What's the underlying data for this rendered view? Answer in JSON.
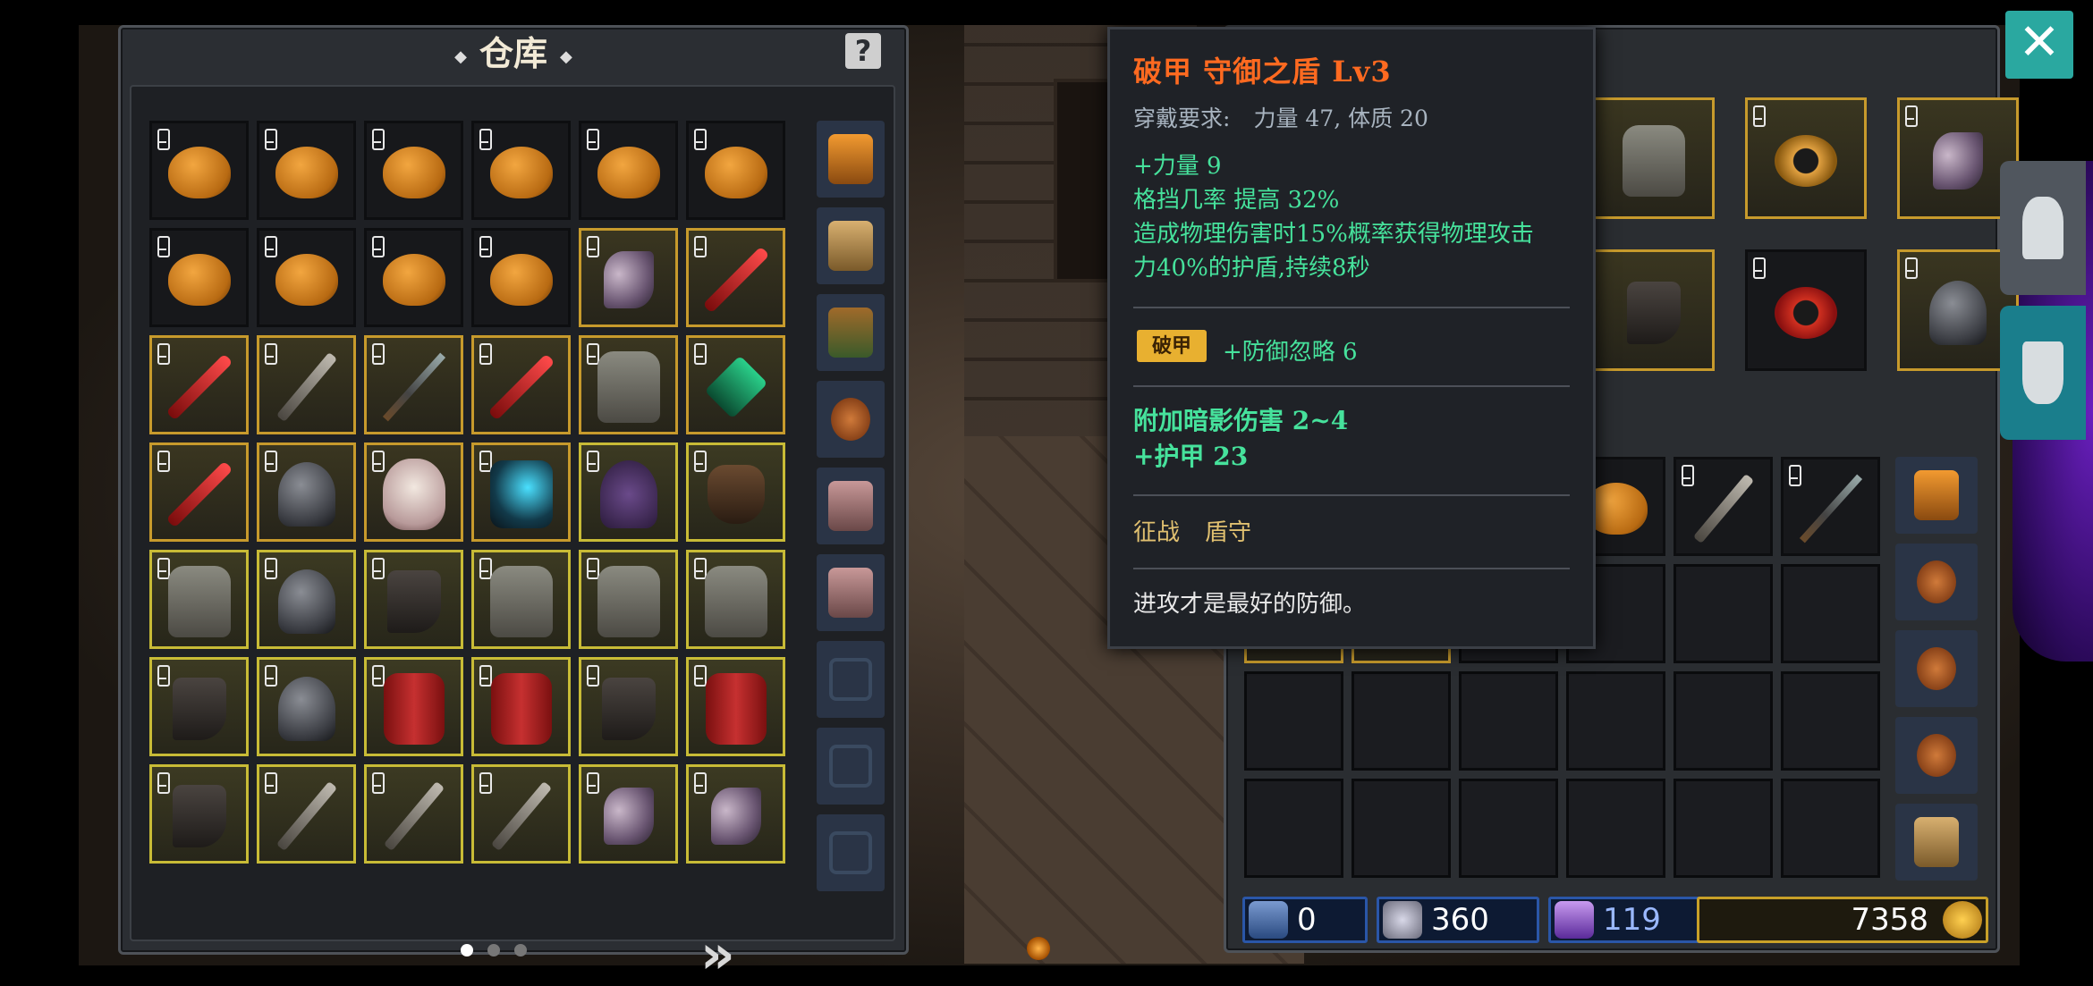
{
  "warehouse": {
    "title": "仓库",
    "help_label": "?",
    "grid": [
      [
        "bag",
        "bag",
        "bag",
        "bag",
        "bag",
        "bag"
      ],
      [
        "bag",
        "bag",
        "bag",
        "bag",
        "axe-gold",
        "blade-gold"
      ],
      [
        "blade-gold",
        "sword-gold",
        "spear-gold",
        "blade-gold",
        "armor-gold",
        "amulet-gold"
      ],
      [
        "blade-gold",
        "helm-gold",
        "skull-gold",
        "teal-gold",
        "purple-ygold",
        "glove-ygold"
      ],
      [
        "armor-ygold",
        "helm-ygold",
        "boot-ygold",
        "armor-ygold",
        "armor-ygold",
        "armor-ygold"
      ],
      [
        "boot-ygold",
        "helm-ygold",
        "red-ygold",
        "red-ygold",
        "boot-ygold",
        "red-ygold"
      ],
      [
        "boot-ygold",
        "sword-ygold",
        "sword-ygold",
        "sword-ygold",
        "axe-ygold",
        "axe-ygold"
      ]
    ],
    "side_tabs": [
      "orange",
      "tan",
      "green",
      "round",
      "pink",
      "pink",
      "locked",
      "locked",
      "locked"
    ],
    "next_label": "»",
    "pages": 3,
    "current_page": 1
  },
  "equipment": {
    "slots": [
      "armor-gold",
      "ring-gold",
      "axe-gold",
      "boot-gold",
      "ring-red",
      "helm-gold"
    ]
  },
  "inventory": {
    "grid": [
      [
        "empty",
        "empty",
        "empty",
        "bag",
        "sword",
        "spear"
      ],
      [
        "gold-partial",
        "gold-partial",
        "empty",
        "empty",
        "empty",
        "empty"
      ],
      [
        "empty",
        "empty",
        "empty",
        "empty",
        "empty",
        "empty"
      ],
      [
        "empty",
        "empty",
        "empty",
        "empty",
        "empty",
        "empty"
      ]
    ],
    "side_tabs": [
      "orange",
      "round",
      "round",
      "round",
      "tan"
    ]
  },
  "currency": {
    "crystal": "0",
    "shield": "360",
    "gem": "119",
    "gold": "7358"
  },
  "close_label": "✕",
  "tooltip": {
    "title": "破甲 守御之盾 Lv3",
    "req_label": "穿戴要求:",
    "req_value": "力量 47, 体质 20",
    "stats": [
      "+力量 9",
      "格挡几率 提高 32%",
      "造成物理伤害时15%概率获得物理攻击",
      "力40%的护盾,持续8秒"
    ],
    "badge": "破甲",
    "badge_effect": "+防御忽略 6",
    "extra": [
      "附加暗影伤害 2~4",
      "+护甲 23"
    ],
    "tags": [
      "征战",
      "盾守"
    ],
    "flavor": "进攻才是最好的防御。"
  }
}
